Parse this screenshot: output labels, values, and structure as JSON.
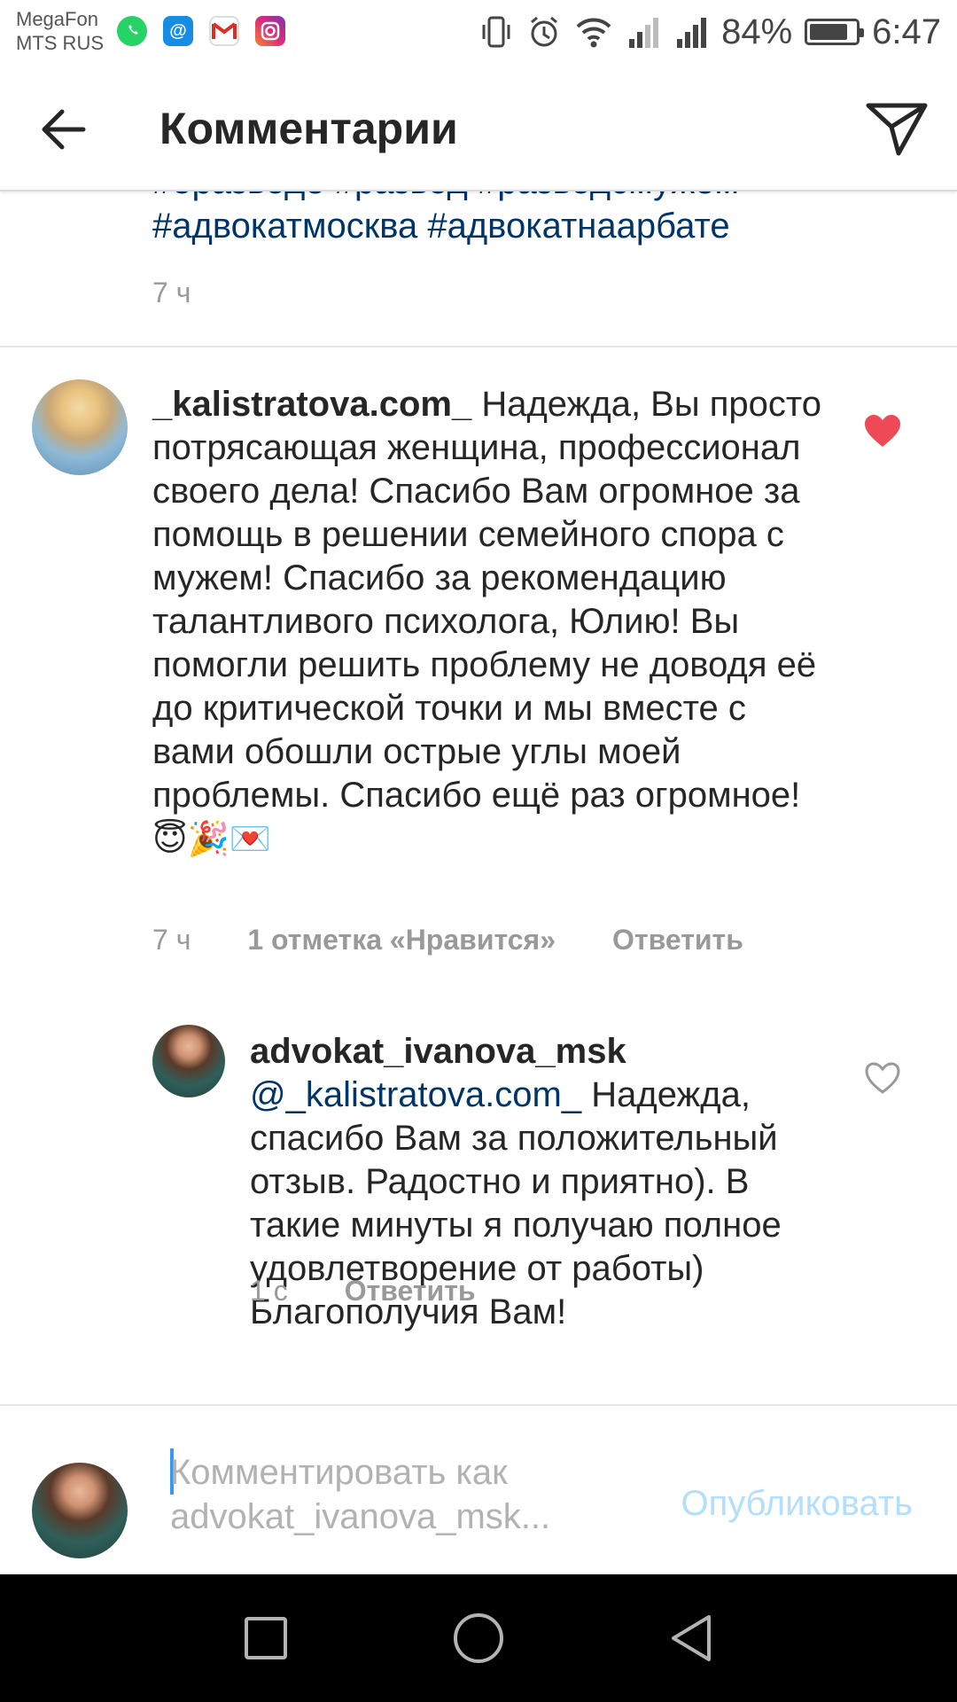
{
  "status_bar": {
    "carrier_line1": "MegaFon",
    "carrier_line2": "MTS RUS",
    "notification_icons": [
      "whatsapp-icon",
      "mail-ru-icon",
      "gmail-icon",
      "instagram-icon"
    ],
    "system_icons": [
      "vibrate-icon",
      "alarm-icon",
      "wifi-icon",
      "signal-icon",
      "signal-icon"
    ],
    "battery_percent": "84%",
    "battery_level": 0.84,
    "time": "6:47"
  },
  "header": {
    "title": "Комментарии",
    "back_icon": "arrow-left-icon",
    "send_icon": "direct-send-icon"
  },
  "caption": {
    "line1": "#оразводе #развод #разводсмужем",
    "line2": "#адвокатмосква #адвокатнаарбате",
    "time": "7 ч"
  },
  "comments": [
    {
      "username": "_kalistratova.com_",
      "text": "Надежда, Вы просто потрясающая женщина, профессионал своего дела! Спасибо Вам огромное за помощь в решении семейного спора с мужем! Спасибо за рекомендацию талантливого психолога, Юлию! Вы помогли решить проблему не доводя её до критической точки и мы вместе с вами обошли острые углы моей проблемы. Спасибо ещё раз огромное!",
      "emojis": "😇🎉💌",
      "time": "7 ч",
      "likes": "1 отметка «Нравится»",
      "reply_label": "Ответить",
      "liked": true,
      "like_color": "#ed4956"
    },
    {
      "username": "advokat_ivanova_msk",
      "mention": "@_kalistratova.com_",
      "text": "Надежда, спасибо Вам за положительный отзыв. Радостно и приятно). В такие минуты я получаю полное удовлетворение от работы) Благополучия Вам!",
      "time": "1 с",
      "reply_label": "Ответить",
      "liked": false
    }
  ],
  "composer": {
    "placeholder_line1": "Комментировать как",
    "placeholder_line2": "advokat_ivanova_msk...",
    "publish_label": "Опубликовать",
    "publish_color": "#b2dffc"
  },
  "nav_bar": {
    "buttons": [
      "recents-square-icon",
      "home-circle-icon",
      "back-triangle-icon"
    ]
  }
}
